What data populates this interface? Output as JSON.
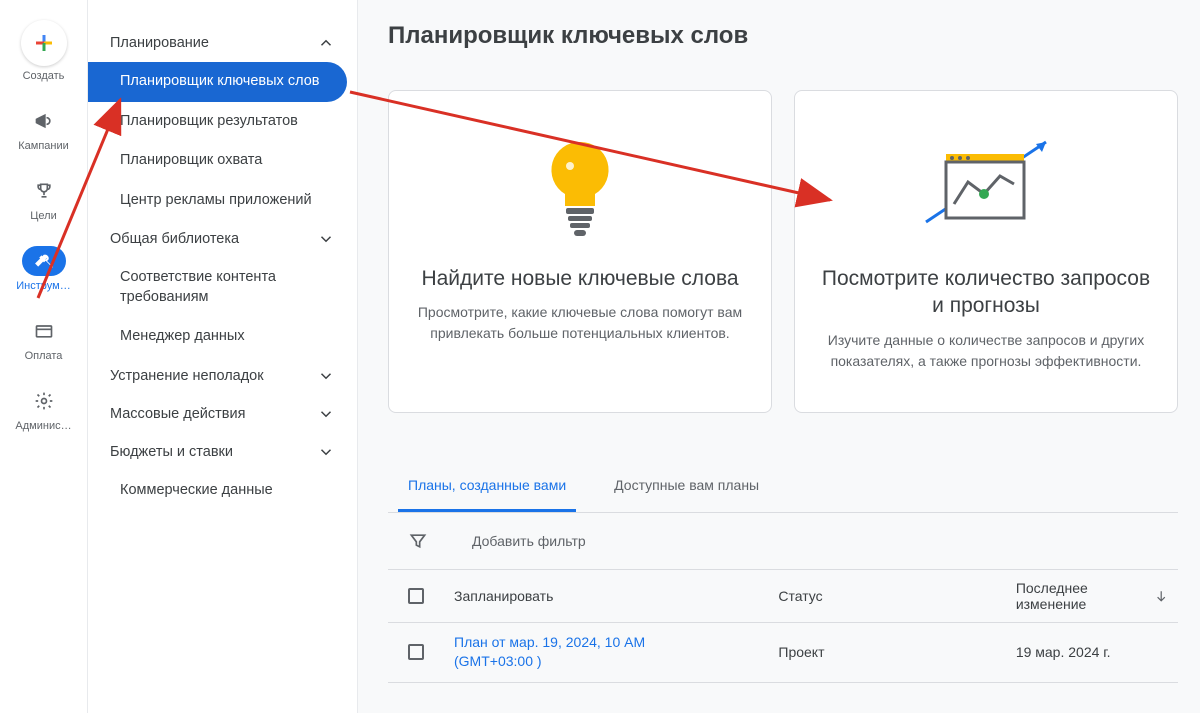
{
  "rail": {
    "create": "Создать",
    "campaigns": "Кампании",
    "goals": "Цели",
    "tools": "Инструм…",
    "payment": "Оплата",
    "admin": "Админис…"
  },
  "nav": {
    "planning": {
      "label": "Планирование",
      "items": {
        "keyword_planner": "Планировщик ключевых слов",
        "performance_planner": "Планировщик результатов",
        "reach_planner": "Планировщик охвата",
        "app_hub": "Центр рекламы приложений"
      }
    },
    "shared_library": "Общая библиотека",
    "policy": "Соответствие контента требованиям",
    "data_manager": "Менеджер данных",
    "troubleshoot": "Устранение неполадок",
    "bulk": "Массовые действия",
    "budgets": "Бюджеты и ставки",
    "commercial": "Коммерческие данные"
  },
  "page": {
    "title": "Планировщик ключевых слов"
  },
  "cards": {
    "discover": {
      "title": "Найдите новые ключевые слова",
      "desc": "Просмотрите, какие ключевые слова помогут вам привлекать больше потенциальных клиентов."
    },
    "forecast": {
      "title": "Посмотрите количество запросов и прогнозы",
      "desc": "Изучите данные о количестве запросов и других показателях, а также прогнозы эффективности."
    }
  },
  "tabs": {
    "your_plans": "Планы, созданные вами",
    "shared_plans": "Доступные вам планы"
  },
  "filter": {
    "label": "Добавить фильтр"
  },
  "table": {
    "headers": {
      "plan": "Запланировать",
      "status": "Статус",
      "last_modified": "Последнее изменение"
    },
    "rows": [
      {
        "plan_line1": "План от мар. 19, 2024, 10 AM",
        "plan_line2": "(GMT+03:00 )",
        "status": "Проект",
        "modified": "19 мар. 2024 г."
      }
    ]
  }
}
